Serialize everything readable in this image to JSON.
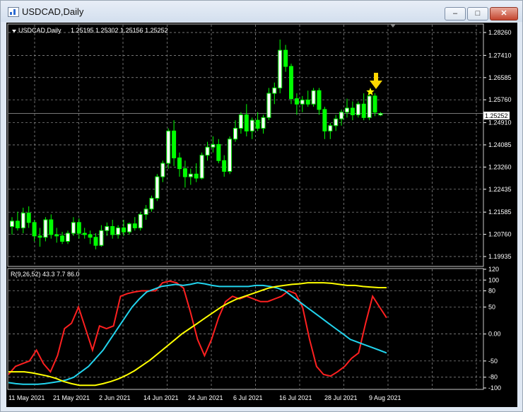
{
  "window": {
    "title": "USDCAD,Daily"
  },
  "chart_data": [
    {
      "type": "candlestick",
      "title": "USDCAD,Daily",
      "ohlc_header": "1.25195 1.25302 1.25156 1.25252",
      "current_price": "1.25252",
      "price_labels": [
        "1.28260",
        "1.27410",
        "1.26585",
        "1.25760",
        "1.24910",
        "1.24085",
        "1.23260",
        "1.22435",
        "1.21585",
        "1.20760",
        "1.19935"
      ],
      "ylim": [
        1.19935,
        1.2826
      ],
      "x_tick_labels": [
        "11 May 2021",
        "21 May 2021",
        "2 Jun 2021",
        "14 Jun 2021",
        "24 Jun 2021",
        "6 Jul 2021",
        "16 Jul 2021",
        "28 Jul 2021",
        "9 Aug 2021"
      ],
      "markers": [
        "star-marker",
        "arrow-down-marker"
      ],
      "colors": {
        "bull": "#ffffff",
        "bear": "#00ff00",
        "background": "#000000",
        "grid": "#c8c8c8"
      },
      "candles": [
        {
          "o": 1.2105,
          "h": 1.214,
          "l": 1.2075,
          "c": 1.2125
        },
        {
          "o": 1.2125,
          "h": 1.216,
          "l": 1.209,
          "c": 1.21
        },
        {
          "o": 1.21,
          "h": 1.2175,
          "l": 1.208,
          "c": 1.2155
        },
        {
          "o": 1.2155,
          "h": 1.218,
          "l": 1.21,
          "c": 1.212
        },
        {
          "o": 1.212,
          "h": 1.213,
          "l": 1.205,
          "c": 1.207
        },
        {
          "o": 1.207,
          "h": 1.21,
          "l": 1.203,
          "c": 1.2065
        },
        {
          "o": 1.2065,
          "h": 1.214,
          "l": 1.205,
          "c": 1.213
        },
        {
          "o": 1.213,
          "h": 1.215,
          "l": 1.206,
          "c": 1.2075
        },
        {
          "o": 1.2075,
          "h": 1.21,
          "l": 1.2045,
          "c": 1.207
        },
        {
          "o": 1.207,
          "h": 1.2085,
          "l": 1.204,
          "c": 1.205
        },
        {
          "o": 1.205,
          "h": 1.209,
          "l": 1.204,
          "c": 1.208
        },
        {
          "o": 1.208,
          "h": 1.214,
          "l": 1.207,
          "c": 1.212
        },
        {
          "o": 1.212,
          "h": 1.2135,
          "l": 1.206,
          "c": 1.208
        },
        {
          "o": 1.208,
          "h": 1.21,
          "l": 1.206,
          "c": 1.2075
        },
        {
          "o": 1.2075,
          "h": 1.209,
          "l": 1.204,
          "c": 1.2065
        },
        {
          "o": 1.2065,
          "h": 1.208,
          "l": 1.202,
          "c": 1.2035
        },
        {
          "o": 1.2035,
          "h": 1.211,
          "l": 1.203,
          "c": 1.209
        },
        {
          "o": 1.209,
          "h": 1.212,
          "l": 1.207,
          "c": 1.2105
        },
        {
          "o": 1.2105,
          "h": 1.213,
          "l": 1.206,
          "c": 1.2075
        },
        {
          "o": 1.2075,
          "h": 1.211,
          "l": 1.206,
          "c": 1.21
        },
        {
          "o": 1.21,
          "h": 1.213,
          "l": 1.207,
          "c": 1.2085
        },
        {
          "o": 1.2085,
          "h": 1.212,
          "l": 1.2075,
          "c": 1.2115
        },
        {
          "o": 1.2115,
          "h": 1.214,
          "l": 1.209,
          "c": 1.21
        },
        {
          "o": 1.21,
          "h": 1.216,
          "l": 1.209,
          "c": 1.215
        },
        {
          "o": 1.215,
          "h": 1.2185,
          "l": 1.213,
          "c": 1.217
        },
        {
          "o": 1.217,
          "h": 1.222,
          "l": 1.216,
          "c": 1.221
        },
        {
          "o": 1.221,
          "h": 1.23,
          "l": 1.22,
          "c": 1.229
        },
        {
          "o": 1.229,
          "h": 1.235,
          "l": 1.227,
          "c": 1.234
        },
        {
          "o": 1.234,
          "h": 1.247,
          "l": 1.232,
          "c": 1.246
        },
        {
          "o": 1.246,
          "h": 1.25,
          "l": 1.233,
          "c": 1.236
        },
        {
          "o": 1.236,
          "h": 1.238,
          "l": 1.229,
          "c": 1.232
        },
        {
          "o": 1.232,
          "h": 1.235,
          "l": 1.225,
          "c": 1.229
        },
        {
          "o": 1.229,
          "h": 1.232,
          "l": 1.226,
          "c": 1.23
        },
        {
          "o": 1.23,
          "h": 1.234,
          "l": 1.227,
          "c": 1.2285
        },
        {
          "o": 1.2285,
          "h": 1.238,
          "l": 1.228,
          "c": 1.237
        },
        {
          "o": 1.237,
          "h": 1.242,
          "l": 1.235,
          "c": 1.24
        },
        {
          "o": 1.24,
          "h": 1.244,
          "l": 1.238,
          "c": 1.241
        },
        {
          "o": 1.241,
          "h": 1.243,
          "l": 1.234,
          "c": 1.235
        },
        {
          "o": 1.235,
          "h": 1.237,
          "l": 1.229,
          "c": 1.231
        },
        {
          "o": 1.231,
          "h": 1.244,
          "l": 1.23,
          "c": 1.243
        },
        {
          "o": 1.243,
          "h": 1.25,
          "l": 1.242,
          "c": 1.247
        },
        {
          "o": 1.247,
          "h": 1.253,
          "l": 1.245,
          "c": 1.252
        },
        {
          "o": 1.252,
          "h": 1.256,
          "l": 1.244,
          "c": 1.246
        },
        {
          "o": 1.246,
          "h": 1.251,
          "l": 1.243,
          "c": 1.25
        },
        {
          "o": 1.25,
          "h": 1.253,
          "l": 1.246,
          "c": 1.247
        },
        {
          "o": 1.247,
          "h": 1.252,
          "l": 1.245,
          "c": 1.251
        },
        {
          "o": 1.251,
          "h": 1.262,
          "l": 1.25,
          "c": 1.26
        },
        {
          "o": 1.26,
          "h": 1.264,
          "l": 1.256,
          "c": 1.262
        },
        {
          "o": 1.262,
          "h": 1.28,
          "l": 1.26,
          "c": 1.276
        },
        {
          "o": 1.276,
          "h": 1.278,
          "l": 1.268,
          "c": 1.27
        },
        {
          "o": 1.27,
          "h": 1.271,
          "l": 1.256,
          "c": 1.258
        },
        {
          "o": 1.258,
          "h": 1.26,
          "l": 1.252,
          "c": 1.256
        },
        {
          "o": 1.256,
          "h": 1.259,
          "l": 1.253,
          "c": 1.2575
        },
        {
          "o": 1.2575,
          "h": 1.261,
          "l": 1.255,
          "c": 1.256
        },
        {
          "o": 1.256,
          "h": 1.262,
          "l": 1.255,
          "c": 1.261
        },
        {
          "o": 1.261,
          "h": 1.262,
          "l": 1.252,
          "c": 1.254
        },
        {
          "o": 1.254,
          "h": 1.255,
          "l": 1.243,
          "c": 1.246
        },
        {
          "o": 1.246,
          "h": 1.249,
          "l": 1.243,
          "c": 1.248
        },
        {
          "o": 1.248,
          "h": 1.252,
          "l": 1.246,
          "c": 1.2505
        },
        {
          "o": 1.2505,
          "h": 1.254,
          "l": 1.248,
          "c": 1.253
        },
        {
          "o": 1.253,
          "h": 1.258,
          "l": 1.251,
          "c": 1.2545
        },
        {
          "o": 1.2545,
          "h": 1.257,
          "l": 1.25,
          "c": 1.252
        },
        {
          "o": 1.252,
          "h": 1.257,
          "l": 1.251,
          "c": 1.256
        },
        {
          "o": 1.256,
          "h": 1.26,
          "l": 1.25,
          "c": 1.251
        },
        {
          "o": 1.251,
          "h": 1.26,
          "l": 1.25,
          "c": 1.259
        },
        {
          "o": 1.259,
          "h": 1.26,
          "l": 1.2515,
          "c": 1.253
        },
        {
          "o": 1.25195,
          "h": 1.25302,
          "l": 1.25156,
          "c": 1.25252
        }
      ]
    },
    {
      "type": "line",
      "indicator_label": "R(9,26,52) 43.3 7.7 86.0",
      "y_tick_labels": [
        "120",
        "100",
        "80",
        "50",
        "0.00",
        "-50",
        "-80",
        "-100"
      ],
      "ylim": [
        -100,
        120
      ],
      "series": [
        {
          "color": "#ff2020",
          "values": [
            -75,
            -60,
            -55,
            -50,
            -30,
            -55,
            -70,
            -40,
            10,
            20,
            50,
            10,
            -30,
            15,
            10,
            15,
            70,
            75,
            78,
            80,
            80,
            80,
            95,
            98,
            95,
            85,
            40,
            -10,
            -40,
            -10,
            30,
            60,
            70,
            65,
            70,
            65,
            60,
            60,
            65,
            70,
            80,
            75,
            50,
            -10,
            -60,
            -75,
            -78,
            -70,
            -60,
            -45,
            -35,
            20,
            70,
            50,
            30
          ]
        },
        {
          "color": "#22d4ee",
          "values": [
            -90,
            -92,
            -93,
            -93,
            -93,
            -92,
            -90,
            -88,
            -85,
            -80,
            -70,
            -60,
            -45,
            -30,
            -10,
            10,
            30,
            50,
            65,
            78,
            83,
            88,
            90,
            92,
            90,
            92,
            95,
            93,
            90,
            88,
            88,
            88,
            88,
            88,
            90,
            90,
            88,
            85,
            80,
            70,
            60,
            50,
            40,
            30,
            20,
            10,
            0,
            -10,
            -15,
            -20,
            -25,
            -30,
            -35
          ]
        },
        {
          "color": "#ffff00",
          "values": [
            -70,
            -70,
            -70,
            -72,
            -75,
            -78,
            -82,
            -88,
            -92,
            -95,
            -95,
            -95,
            -92,
            -88,
            -83,
            -76,
            -68,
            -58,
            -48,
            -36,
            -24,
            -12,
            0,
            10,
            20,
            30,
            40,
            50,
            58,
            65,
            70,
            75,
            80,
            85,
            88,
            90,
            92,
            93,
            95,
            95,
            95,
            94,
            92,
            90,
            90,
            88,
            87,
            86,
            86
          ]
        }
      ]
    }
  ]
}
